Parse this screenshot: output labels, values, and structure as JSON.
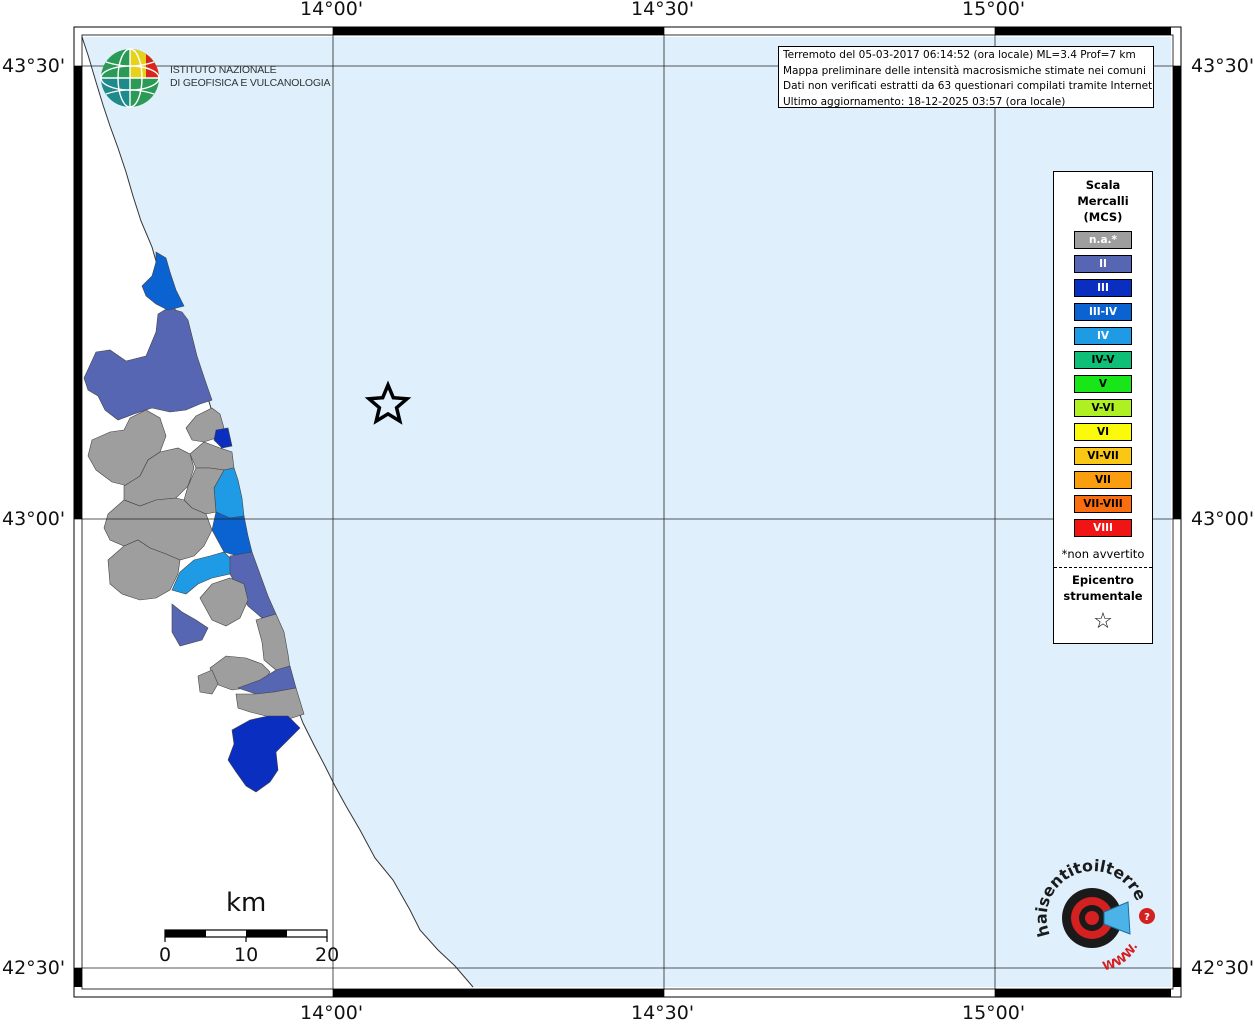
{
  "map": {
    "lat_labels": [
      "43°30'",
      "43°00'",
      "42°30'"
    ],
    "lon_labels": [
      "14°00'",
      "14°30'",
      "15°00'"
    ]
  },
  "institute": {
    "line1": "ISTITUTO NAZIONALE",
    "line2": "DI GEOFISICA E VULCANOLOGIA"
  },
  "info": {
    "line1": "Terremoto del 05-03-2017 06:14:52 (ora locale) ML=3.4 Prof=7 km",
    "line2": "Mappa preliminare delle intensità macrosismiche stimate nei comuni",
    "line3": "Dati non verificati estratti da 63 questionari compilati tramite Internet.",
    "line4": "Ultimo aggiornamento: 18-12-2025 03:57 (ora locale)"
  },
  "legend": {
    "title_1": "Scala",
    "title_2": "Mercalli",
    "title_3": "(MCS)",
    "items": [
      {
        "label": "n.a.*",
        "color": "#9e9e9e",
        "text_color": "#ffffff"
      },
      {
        "label": "II",
        "color": "#5766b2",
        "text_color": "#ffffff"
      },
      {
        "label": "III",
        "color": "#0a2ec0",
        "text_color": "#ffffff"
      },
      {
        "label": "III-IV",
        "color": "#0a63d1",
        "text_color": "#ffffff"
      },
      {
        "label": "IV",
        "color": "#1f9be6",
        "text_color": "#ffffff"
      },
      {
        "label": "IV-V",
        "color": "#0fbf78",
        "text_color": "#000000"
      },
      {
        "label": "V",
        "color": "#19e619",
        "text_color": "#000000"
      },
      {
        "label": "V-VI",
        "color": "#aef021",
        "text_color": "#000000"
      },
      {
        "label": "VI",
        "color": "#fafa0a",
        "text_color": "#000000"
      },
      {
        "label": "VI-VII",
        "color": "#fac814",
        "text_color": "#000000"
      },
      {
        "label": "VII",
        "color": "#fa9e0f",
        "text_color": "#000000"
      },
      {
        "label": "VII-VIII",
        "color": "#fa6e0f",
        "text_color": "#000000"
      },
      {
        "label": "VIII",
        "color": "#f01414",
        "text_color": "#ffffff"
      }
    ],
    "note": "*non avvertito",
    "epicenter_1": "Epicentro",
    "epicenter_2": "strumentale",
    "epicenter_symbol": "☆"
  },
  "scalebar": {
    "title": "km",
    "ticks": [
      "0",
      "10",
      "20"
    ]
  },
  "logo": {
    "text": "haisentitoilterremoto.it",
    "url_text": "WWW."
  },
  "colors": {
    "sea": "#dff0fc",
    "land": "#ffffff",
    "grid": "#222222"
  }
}
